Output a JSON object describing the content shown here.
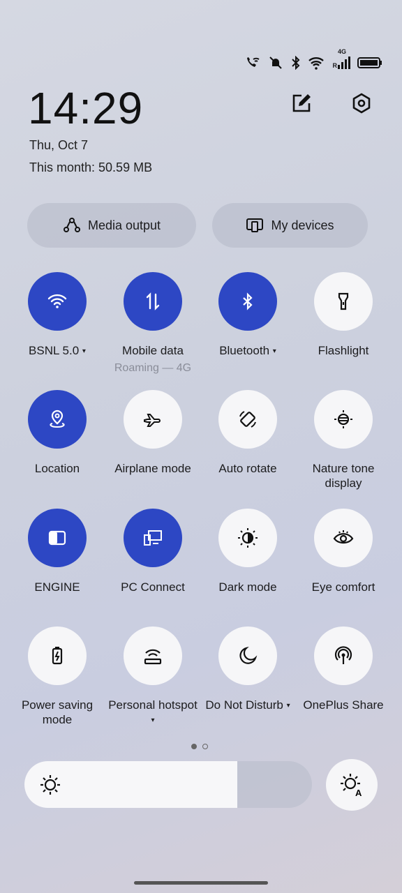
{
  "status_bar": {
    "icons": [
      "wifi-calling-icon",
      "vibrate-off-icon",
      "bluetooth-icon",
      "wifi-icon",
      "signal-4g-roaming-icon",
      "battery-icon"
    ],
    "network": "4G",
    "roaming": "R"
  },
  "header": {
    "time": "14:29",
    "date": "Thu, Oct 7",
    "usage": "This month: 50.59 MB",
    "edit_icon": "edit-icon",
    "settings_icon": "settings-icon"
  },
  "pills": [
    {
      "label": "Media output",
      "icon": "media-output-icon"
    },
    {
      "label": "My devices",
      "icon": "devices-icon"
    }
  ],
  "accent": "#2d47c4",
  "tiles": [
    {
      "label": "BSNL 5.0",
      "caret": "▾",
      "on": true,
      "icon": "wifi-icon"
    },
    {
      "label": "Mobile data",
      "sub": "Roaming — 4G",
      "on": true,
      "icon": "mobile-data-icon"
    },
    {
      "label": "Bluetooth",
      "caret": "▾",
      "on": true,
      "icon": "bluetooth-icon"
    },
    {
      "label": "Flashlight",
      "on": false,
      "icon": "flashlight-icon"
    },
    {
      "label": "Location",
      "on": true,
      "icon": "location-icon"
    },
    {
      "label": "Airplane mode",
      "on": false,
      "icon": "airplane-icon"
    },
    {
      "label": "Auto rotate",
      "on": false,
      "icon": "auto-rotate-icon"
    },
    {
      "label": "Nature tone display",
      "on": false,
      "icon": "nature-tone-icon"
    },
    {
      "label": "ENGINE",
      "on": true,
      "icon": "engine-icon"
    },
    {
      "label": "PC Connect",
      "on": true,
      "icon": "pc-connect-icon"
    },
    {
      "label": "Dark mode",
      "on": false,
      "icon": "dark-mode-icon"
    },
    {
      "label": "Eye comfort",
      "on": false,
      "icon": "eye-comfort-icon"
    },
    {
      "label": "Power saving mode",
      "on": false,
      "icon": "battery-saver-icon"
    },
    {
      "label": "Personal hotspot",
      "caret": "▾",
      "on": false,
      "icon": "hotspot-icon"
    },
    {
      "label": "Do Not Disturb",
      "caret": "▾",
      "on": false,
      "icon": "moon-icon"
    },
    {
      "label": "OnePlus Share",
      "on": false,
      "icon": "share-icon"
    }
  ],
  "pages": {
    "current": 1,
    "total": 2
  },
  "brightness": {
    "level_percent": 74,
    "icon": "brightness-icon",
    "auto_icon": "auto-brightness-icon"
  }
}
